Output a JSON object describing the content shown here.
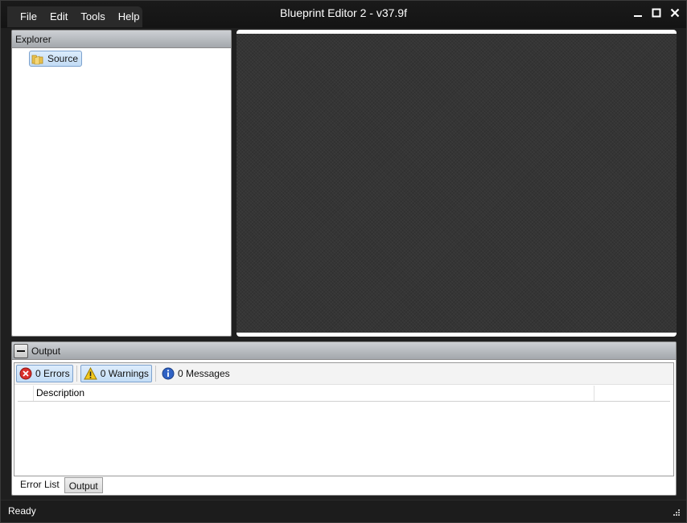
{
  "window": {
    "title": "Blueprint Editor 2 - v37.9f"
  },
  "menu": {
    "items": [
      "File",
      "Edit",
      "Tools",
      "Help"
    ]
  },
  "explorer": {
    "header": "Explorer",
    "tree": [
      {
        "label": "Source",
        "icon": "folder-icon"
      }
    ]
  },
  "output": {
    "header": "Output",
    "toolbar": {
      "errors": "0 Errors",
      "warnings": "0 Warnings",
      "messages": "0 Messages"
    },
    "columns": {
      "description": "Description"
    },
    "tabs": [
      "Error List",
      "Output"
    ]
  },
  "status": {
    "text": "Ready"
  },
  "colors": {
    "canvas": "#353535",
    "selection": "#c2dcf5",
    "titlebar": "#141414"
  }
}
